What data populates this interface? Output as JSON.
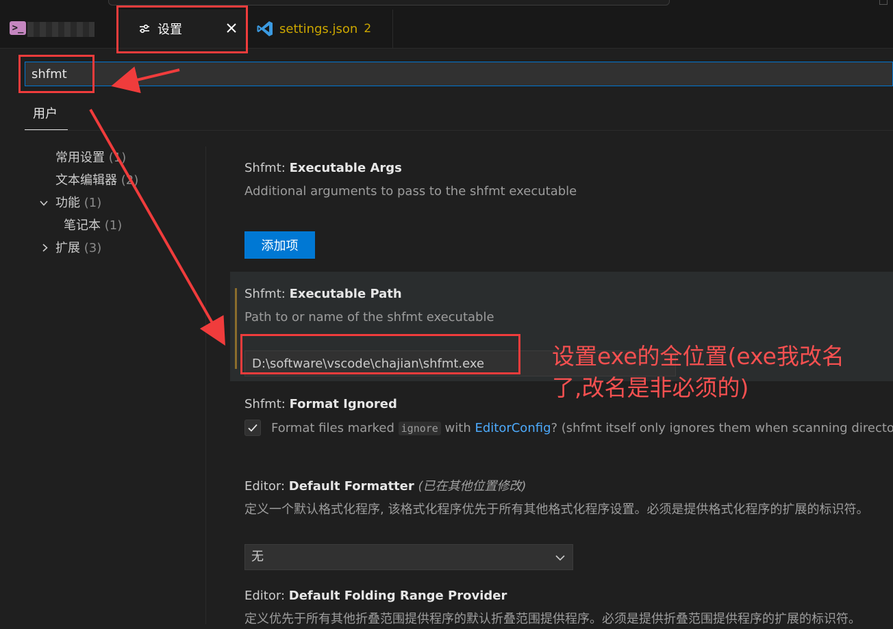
{
  "tabs": [
    {
      "label": "设置",
      "icon": "settings-sliders-icon",
      "active": true,
      "close_icon": "close-icon"
    },
    {
      "label": "settings.json",
      "icon": "vscode-icon",
      "badge": "2",
      "color": "#cca700"
    }
  ],
  "terminal_icon": "terminal-icon",
  "search": {
    "value": "shfmt"
  },
  "scope_tab": {
    "label": "用户"
  },
  "toc": [
    {
      "label": "常用设置",
      "count": "(1)"
    },
    {
      "label": "文本编辑器",
      "count": "(2)"
    },
    {
      "label": "功能",
      "count": "(1)",
      "chevron": "chevron-down-icon"
    },
    {
      "label": "笔记本",
      "count": "(1)"
    },
    {
      "label": "扩展",
      "count": "(3)",
      "chevron": "chevron-right-icon"
    }
  ],
  "settings": {
    "args": {
      "category": "Shfmt: ",
      "name": "Executable Args",
      "description": "Additional arguments to pass to the shfmt executable",
      "button_label": "添加项"
    },
    "path": {
      "category": "Shfmt: ",
      "name": "Executable Path",
      "description": "Path to or name of the shfmt executable",
      "value": "D:\\software\\vscode\\chajian\\shfmt.exe"
    },
    "ignored": {
      "category": "Shfmt: ",
      "name": "Format Ignored",
      "text_before": "Format files marked ",
      "code": "ignore",
      "text_mid": " with ",
      "link": "EditorConfig",
      "text_after": "? (shfmt itself only ignores them when scanning directories.)",
      "checked": true
    },
    "formatter": {
      "category": "Editor: ",
      "name": "Default Formatter",
      "modified": "(已在其他位置修改)",
      "description": "定义一个默认格式化程序, 该格式化程序优先于所有其他格式化程序设置。必须是提供格式化程序的扩展的标识符。",
      "select_value": "无"
    },
    "folding": {
      "category": "Editor: ",
      "name": "Default Folding Range Provider",
      "description": "定义优先于所有其他折叠范围提供程序的默认折叠范围提供程序。必须是提供折叠范围提供程序的扩展的标识符。"
    }
  },
  "annotation": {
    "line1": "设置exe的全位置(exe我改名",
    "line2": "了,改名是非必须的)",
    "color": "#f03c3c"
  }
}
